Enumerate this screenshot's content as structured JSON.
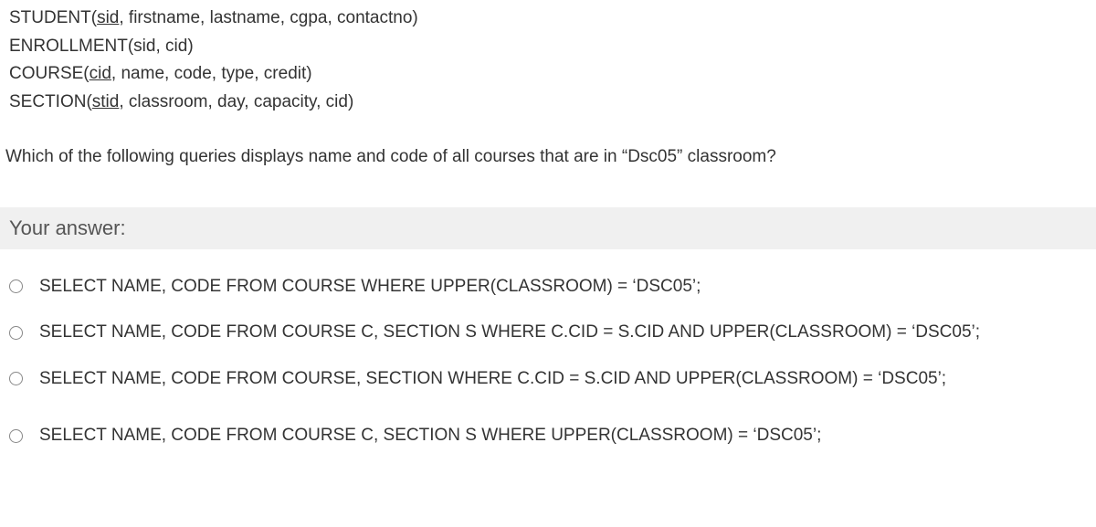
{
  "schema": {
    "line1_pre": "STUDENT(",
    "line1_key": "sid",
    "line1_post": ", firstname, lastname, cgpa, contactno)",
    "line2": "ENROLLMENT(sid, cid)",
    "line3_pre": "COURSE(",
    "line3_key": "cid",
    "line3_post": ", name, code, type, credit)",
    "line4_pre": "SECTION(",
    "line4_key": "stid",
    "line4_post": ", classroom, day, capacity, cid)"
  },
  "question": "Which of the following queries displays name and code of all courses that are in “Dsc05” classroom?",
  "answer_label": "Your answer:",
  "options": [
    "SELECT NAME, CODE FROM COURSE WHERE UPPER(CLASSROOM) = ‘DSC05’;",
    "SELECT NAME, CODE FROM COURSE C, SECTION S WHERE C.CID = S.CID AND UPPER(CLASSROOM) = ‘DSC05’;",
    "SELECT NAME, CODE FROM COURSE, SECTION WHERE C.CID = S.CID AND UPPER(CLASSROOM) = ‘DSC05’;",
    "SELECT NAME, CODE FROM COURSE C, SECTION S WHERE UPPER(CLASSROOM) = ‘DSC05’;"
  ]
}
